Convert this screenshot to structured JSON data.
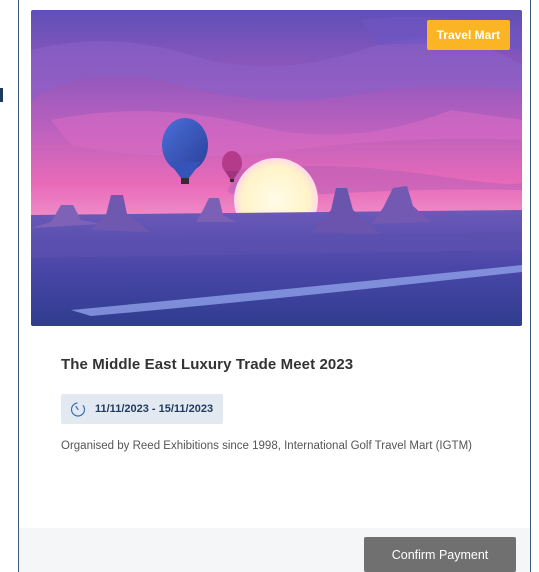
{
  "event": {
    "badge": "Travel Mart",
    "title": "The Middle East Luxury Trade Meet 2023",
    "date_range": "11/11/2023 - 15/11/2023",
    "organiser": "Organised by Reed Exhibitions since 1998, International Golf Travel Mart (IGTM)",
    "image_semantic": "hot-air-balloons-desert-sunset"
  },
  "footer": {
    "confirm_label": "Confirm Payment"
  },
  "colors": {
    "badge": "#fbb424",
    "date_pill_bg": "#e2e9f1",
    "date_text": "#1f3a5f",
    "button_bg": "#707070"
  }
}
